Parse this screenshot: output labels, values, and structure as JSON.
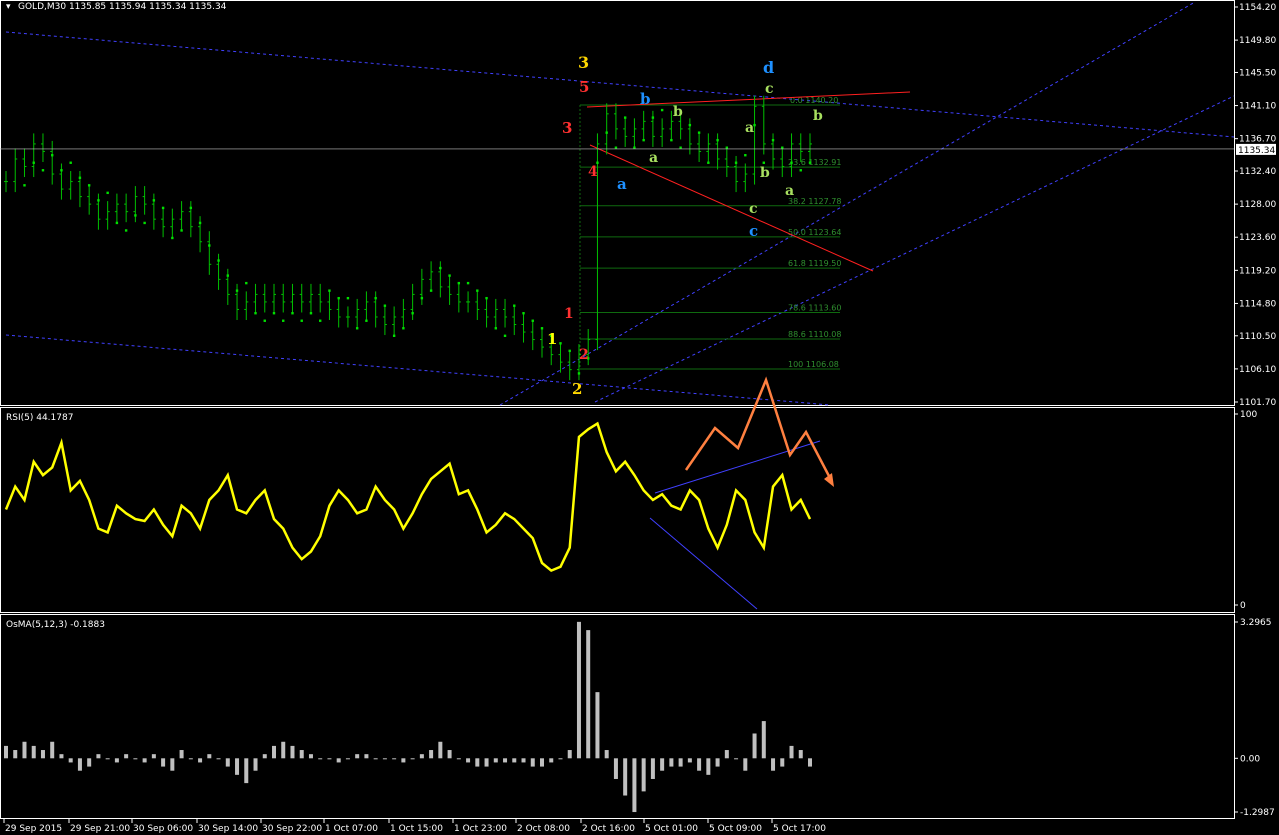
{
  "header": {
    "symbol_line": "GOLD,M30  1135.85 1135.94 1135.34 1135.34",
    "rsi_label": "RSI(5) 44.1787",
    "osma_label": "OsMA(5,12,3) -0.1883"
  },
  "colors": {
    "background": "#000000",
    "bars": "#00c000",
    "sar": "#00e000",
    "rsi": "#ffff00",
    "osma": "#c0c0c0",
    "channel": "#4040ff",
    "fib": "#0f6a0f",
    "triangle": "#ff2020",
    "arrow": "#ff8040"
  },
  "chart_data": [
    {
      "type": "bar",
      "panel": "price",
      "ylim": [
        1101.7,
        1154.2
      ],
      "yticks": [
        "1154.20",
        "1149.80",
        "1145.50",
        "1141.10",
        "1136.70",
        "1132.40",
        "1128.00",
        "1123.60",
        "1119.20",
        "1114.80",
        "1110.50",
        "1106.10",
        "1101.70"
      ],
      "current_price": "1135.34",
      "close_series": [
        1131,
        1134,
        1133,
        1136,
        1135,
        1132,
        1130,
        1131,
        1129,
        1128,
        1126,
        1127,
        1128,
        1127,
        1129,
        1128,
        1126,
        1125,
        1126,
        1127,
        1125,
        1123,
        1120,
        1118,
        1116,
        1114,
        1115,
        1116,
        1115,
        1116,
        1115,
        1116,
        1115,
        1116,
        1115,
        1114,
        1113,
        1113,
        1114,
        1115,
        1113,
        1112,
        1113,
        1114,
        1116,
        1118,
        1119,
        1117,
        1116,
        1115,
        1115,
        1114,
        1113,
        1114,
        1113,
        1112,
        1111,
        1110,
        1109,
        1108,
        1107,
        1106,
        1108,
        1110,
        1136,
        1140,
        1138,
        1137,
        1138,
        1139,
        1137,
        1138,
        1139,
        1138,
        1136,
        1135,
        1136,
        1134,
        1133,
        1131,
        1132,
        1141,
        1136,
        1134,
        1133,
        1136,
        1135,
        1136
      ],
      "fib_levels": [
        {
          "label": "23.6 1132.91",
          "value": 1132.91
        },
        {
          "label": "38.2 1127.78",
          "value": 1127.78
        },
        {
          "label": "50.0 1123.64",
          "value": 1123.64
        },
        {
          "label": "61.8 1119.50",
          "value": 1119.5
        },
        {
          "label": "78.6 1113.60",
          "value": 1113.6
        },
        {
          "label": "88.6 1110.08",
          "value": 1110.08
        },
        {
          "label": "100 1106.08",
          "value": 1106.08
        }
      ],
      "fib_top_label": "0.0 1140.20",
      "wave_labels": [
        {
          "text": "3",
          "color": "#ffd700",
          "size": 16
        },
        {
          "text": "5",
          "color": "#ff3030",
          "size": 15
        },
        {
          "text": "3",
          "color": "#ff3030",
          "size": 15
        },
        {
          "text": "4",
          "color": "#ff3030",
          "size": 14
        },
        {
          "text": "1",
          "color": "#ff3030",
          "size": 14
        },
        {
          "text": "2",
          "color": "#ff3030",
          "size": 14
        },
        {
          "text": "1",
          "color": "#ffff00",
          "size": 15
        },
        {
          "text": "2",
          "color": "#ffd700",
          "size": 15
        },
        {
          "text": "b",
          "color": "#1e90ff",
          "size": 15
        },
        {
          "text": "a",
          "color": "#1e90ff",
          "size": 15
        },
        {
          "text": "b",
          "color": "#a8e060",
          "size": 14
        },
        {
          "text": "a",
          "color": "#a8e060",
          "size": 14
        },
        {
          "text": "a",
          "color": "#a8e060",
          "size": 14
        },
        {
          "text": "d",
          "color": "#1e90ff",
          "size": 16
        },
        {
          "text": "c",
          "color": "#a8e060",
          "size": 14
        },
        {
          "text": "b",
          "color": "#a8e060",
          "size": 14
        },
        {
          "text": "b",
          "color": "#a8e060",
          "size": 14
        },
        {
          "text": "a",
          "color": "#a8e060",
          "size": 14
        },
        {
          "text": "c",
          "color": "#a8e060",
          "size": 14
        },
        {
          "text": "c",
          "color": "#1e90ff",
          "size": 15
        }
      ]
    },
    {
      "type": "line",
      "panel": "rsi",
      "ylim": [
        0,
        100
      ],
      "yticks": [
        "100",
        "0"
      ],
      "series": [
        {
          "values": [
            50,
            62,
            55,
            75,
            68,
            72,
            85,
            60,
            65,
            55,
            40,
            38,
            52,
            48,
            45,
            44,
            50,
            42,
            36,
            52,
            48,
            40,
            55,
            60,
            68,
            50,
            48,
            55,
            60,
            45,
            40,
            30,
            24,
            28,
            36,
            52,
            60,
            55,
            48,
            50,
            62,
            55,
            50,
            40,
            48,
            58,
            66,
            70,
            74,
            58,
            60,
            50,
            38,
            42,
            48,
            45,
            40,
            35,
            22,
            18,
            20,
            30,
            88,
            92,
            95,
            80,
            70,
            75,
            68,
            60,
            55,
            58,
            52,
            50,
            60,
            55,
            40,
            30,
            42,
            60,
            55,
            38,
            30,
            62,
            68,
            50,
            55,
            45
          ]
        }
      ]
    },
    {
      "type": "bar",
      "panel": "osma",
      "ylim": [
        -1.2987,
        3.2965
      ],
      "yticks": [
        "3.2965",
        "0.00",
        "-1.2987"
      ],
      "values": [
        0.3,
        0.2,
        0.4,
        0.3,
        0.2,
        0.4,
        0.1,
        -0.1,
        -0.3,
        -0.2,
        0.1,
        0.0,
        -0.1,
        0.1,
        0.0,
        -0.1,
        0.1,
        -0.2,
        -0.3,
        0.2,
        0.0,
        -0.1,
        0.1,
        0.0,
        -0.2,
        -0.4,
        -0.6,
        -0.3,
        0.1,
        0.3,
        0.4,
        0.3,
        0.2,
        0.1,
        0.0,
        0.0,
        -0.1,
        0.0,
        0.1,
        0.1,
        0.0,
        0.0,
        0.0,
        -0.1,
        0.0,
        0.1,
        0.2,
        0.4,
        0.2,
        0.0,
        -0.1,
        -0.2,
        -0.2,
        -0.1,
        -0.1,
        -0.1,
        -0.1,
        -0.2,
        -0.2,
        -0.1,
        0.0,
        0.2,
        3.3,
        3.1,
        1.6,
        0.2,
        -0.5,
        -0.9,
        -1.3,
        -0.8,
        -0.5,
        -0.3,
        -0.2,
        -0.2,
        -0.1,
        -0.3,
        -0.4,
        -0.2,
        0.2,
        0.0,
        -0.3,
        0.6,
        0.9,
        -0.3,
        -0.2,
        0.3,
        0.2,
        -0.2
      ]
    }
  ],
  "time_axis": [
    "29 Sep 2015",
    "29 Sep 21:00",
    "30 Sep 06:00",
    "30 Sep 14:00",
    "30 Sep 22:00",
    "1 Oct 07:00",
    "1 Oct 15:00",
    "1 Oct 23:00",
    "2 Oct 08:00",
    "2 Oct 16:00",
    "5 Oct 01:00",
    "5 Oct 09:00",
    "5 Oct 17:00"
  ]
}
